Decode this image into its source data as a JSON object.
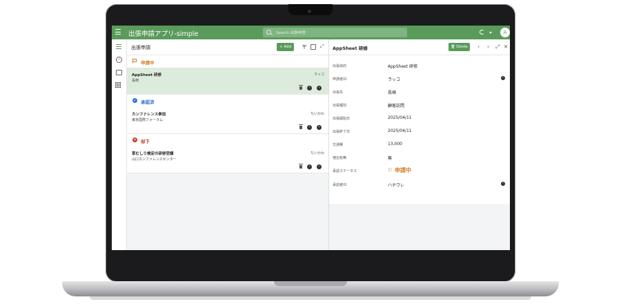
{
  "app": {
    "title": "出張申請アプリ-simple",
    "avatar_initial": "A"
  },
  "search": {
    "placeholder": "Search 出張申請"
  },
  "list": {
    "title": "出張申請",
    "add_label": "Add",
    "groups": [
      {
        "label": "申請中",
        "color": "#d17a22",
        "rows": [
          {
            "title": "AppSheet 研修",
            "subtitle": "長崎",
            "user": "ラッコ",
            "selected": true
          }
        ]
      },
      {
        "label": "承認済",
        "color": "#2f6fd6",
        "rows": [
          {
            "title": "カンファレンス参加",
            "subtitle": "東京国際フォーラム",
            "user": "ちいかわ",
            "selected": false
          }
        ]
      },
      {
        "label": "却下",
        "color": "#c0392b",
        "rows": [
          {
            "title": "草むしり検定の研修受講",
            "subtitle": "山口カンファレンスセンター",
            "user": "ちいかわ",
            "selected": false
          }
        ]
      }
    ]
  },
  "detail": {
    "title": "AppSheet 研修",
    "delete_label": "Delete",
    "fields": [
      {
        "label": "出張目的",
        "value": "AppSheet 研修"
      },
      {
        "label": "申請者ID",
        "value": "ラッコ"
      },
      {
        "label": "出張先",
        "value": "長崎"
      },
      {
        "label": "出張種別",
        "value": "顧客訪問"
      },
      {
        "label": "出張開始日",
        "value": "2025/04/11"
      },
      {
        "label": "出張終了日",
        "value": "2025/04/11"
      },
      {
        "label": "交通費",
        "value": "13,000"
      },
      {
        "label": "宿泊有無",
        "value": "無"
      },
      {
        "label": "承認ステータス",
        "value": "申請中"
      },
      {
        "label": "承認者ID",
        "value": "ハチワレ"
      }
    ]
  },
  "colors": {
    "brand": "#5a9b5c",
    "pending": "#d17a22"
  }
}
